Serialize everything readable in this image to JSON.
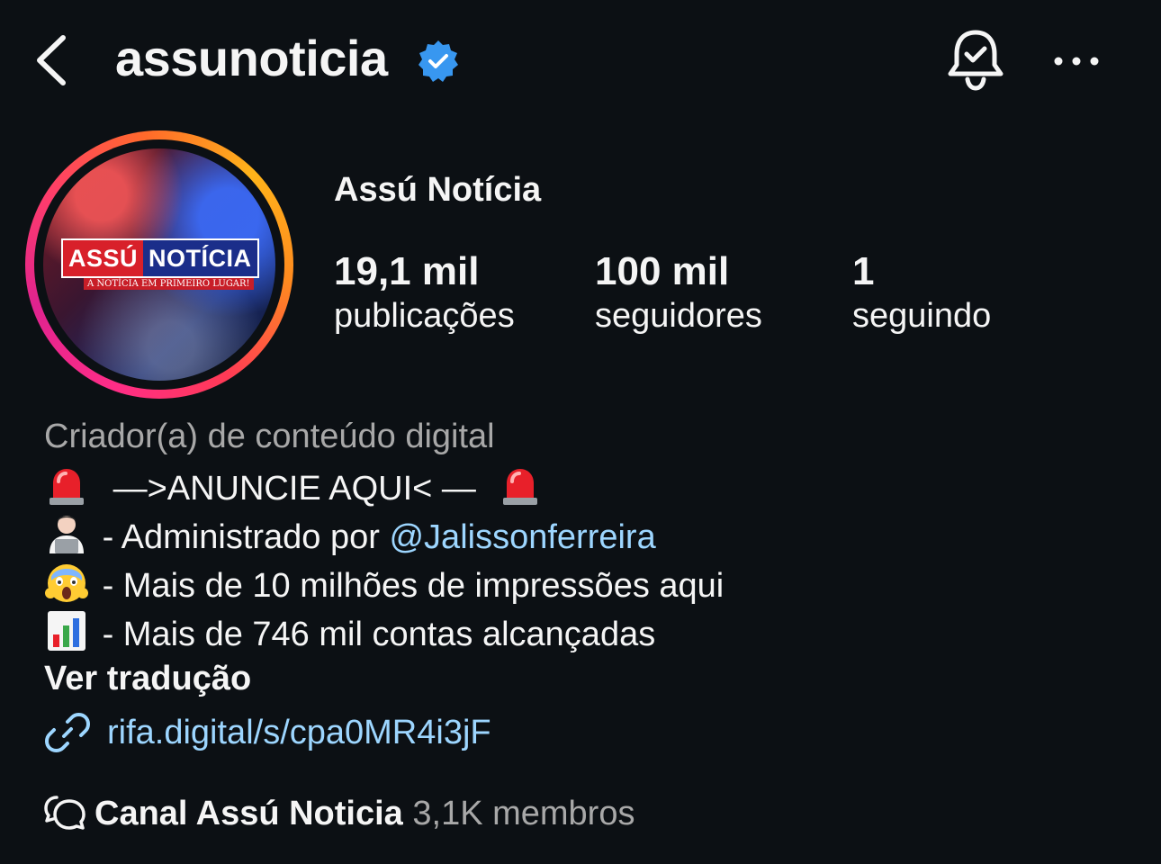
{
  "header": {
    "username": "assunoticia",
    "icons": {
      "back": "chevron-left-icon",
      "verified": "verified-badge-icon",
      "bell": "notification-bell-icon",
      "more": "more-options-icon"
    },
    "verified_color": "#3897f0"
  },
  "avatar": {
    "logo_left": "ASSÚ",
    "logo_right": "NOTÍCIA",
    "logo_tagline": "A NOTÍCIA EM PRIMEIRO LUGAR!"
  },
  "profile": {
    "display_name": "Assú Notícia",
    "stats": [
      {
        "value": "19,1 mil",
        "label": "publicações"
      },
      {
        "value": "100 mil",
        "label": "seguidores"
      },
      {
        "value": "1",
        "label": "seguindo"
      }
    ]
  },
  "bio": {
    "category": "Criador(a) de conteúdo digital",
    "line1_text": "—>ANUNCIE AQUI< —",
    "line2_prefix": "- Administrado por ",
    "line2_mention": "@Jalissonferreira",
    "line3_text": "- Mais de 10 milhões de impressões aqui",
    "line4_text": "- Mais de 746 mil contas alcançadas",
    "emojis": [
      "siren-emoji",
      "technologist-emoji",
      "screaming-face-emoji",
      "bar-chart-emoji"
    ],
    "translate_label": "Ver tradução",
    "link": "rifa.digital/s/cpa0MR4i3jF"
  },
  "channel": {
    "name": "Canal Assú Noticia",
    "members": "3,1K membros"
  },
  "colors": {
    "background": "#0c1014",
    "link": "#9dd6ff",
    "secondary_text": "#a8a8a8"
  }
}
